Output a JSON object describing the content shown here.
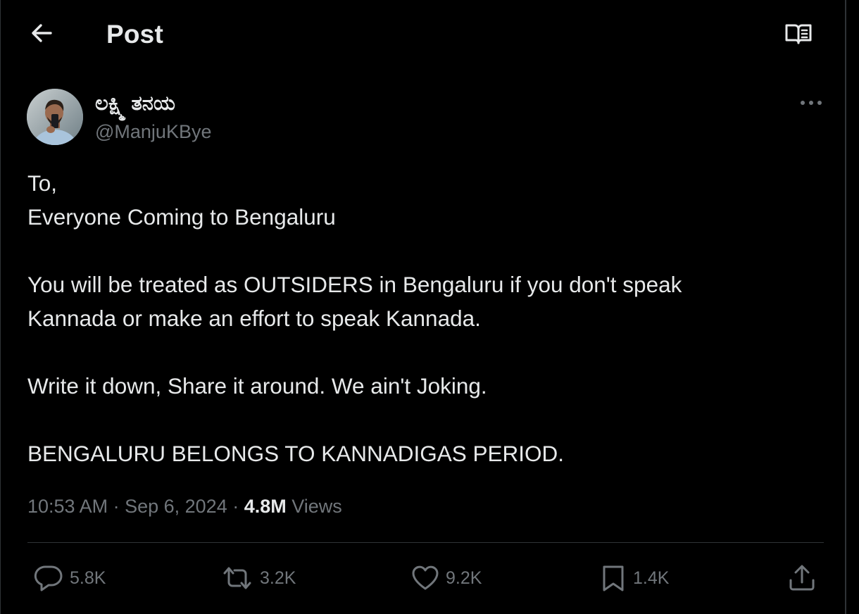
{
  "header": {
    "title": "Post",
    "back_icon": "arrow-left-icon",
    "reader_icon": "open-book-icon"
  },
  "author": {
    "display_name": "ಲಕ್ಷ್ಮಿ ತನಯ",
    "handle": "@ManjuKBye",
    "more_icon": "more-horizontal-icon"
  },
  "tweet": {
    "lines": [
      "To,",
      "Everyone Coming to Bengaluru",
      "",
      "You will be treated as OUTSIDERS in Bengaluru if you don't speak",
      "Kannada or make an effort to speak Kannada.",
      "",
      "Write it down, Share it around. We ain't Joking.",
      "",
      "BENGALURU BELONGS TO KANNADIGAS PERIOD."
    ]
  },
  "meta": {
    "time": "10:53 AM",
    "sep1": " · ",
    "date": "Sep 6, 2024",
    "sep2": " · ",
    "views_count": "4.8M",
    "views_label": " Views"
  },
  "actions": {
    "reply": {
      "icon": "reply-bubble-icon",
      "count": "5.8K"
    },
    "repost": {
      "icon": "repost-icon",
      "count": "3.2K"
    },
    "like": {
      "icon": "heart-icon",
      "count": "9.2K"
    },
    "bookmark": {
      "icon": "bookmark-icon",
      "count": "1.4K"
    },
    "share": {
      "icon": "share-upload-icon"
    }
  },
  "colors": {
    "background": "#000000",
    "text_primary": "#e7e9ea",
    "text_secondary": "#71767b",
    "border": "#2f3336"
  }
}
